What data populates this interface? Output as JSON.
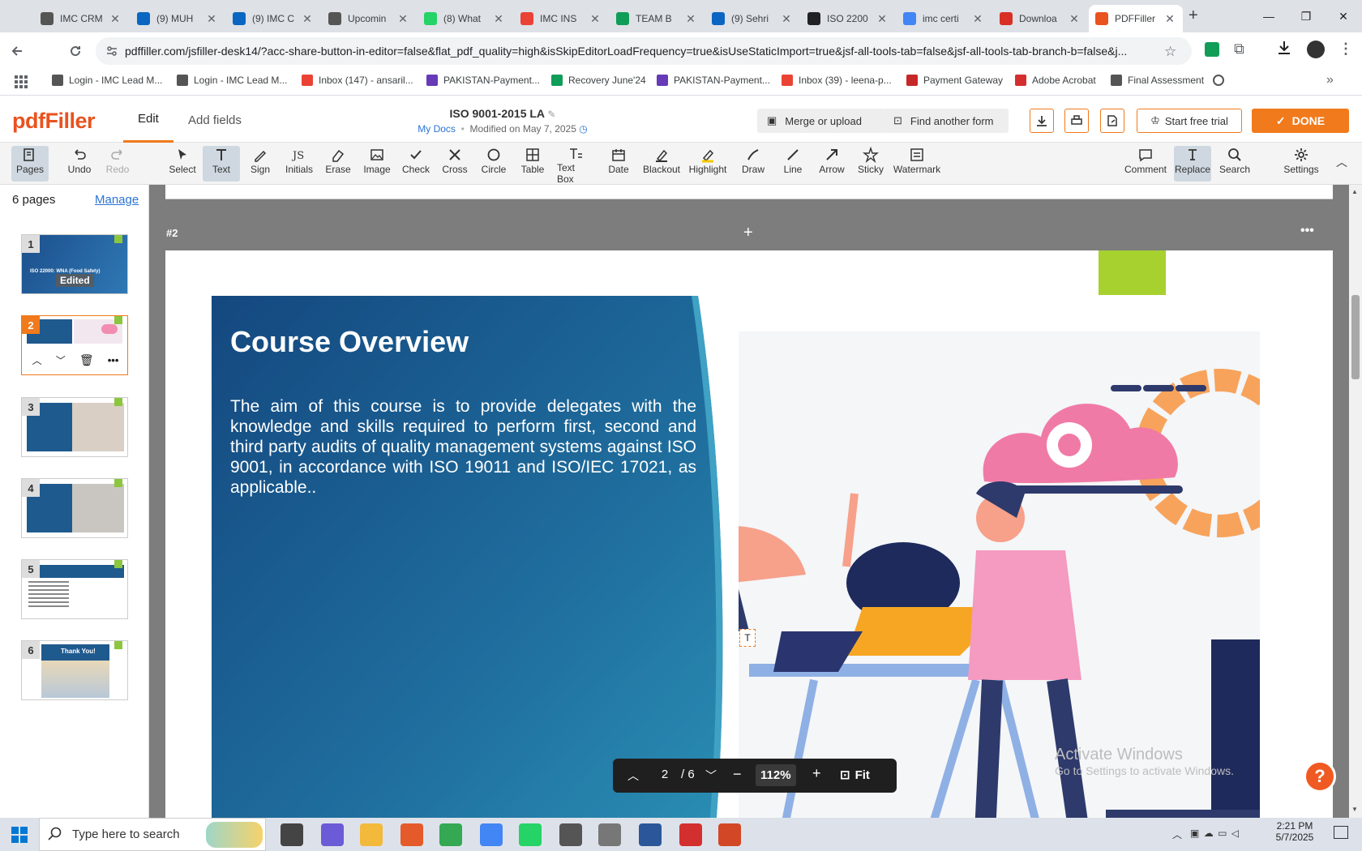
{
  "browser": {
    "tabs": [
      {
        "title": "IMC CRM",
        "icon": "gear-favicon",
        "color": "#555555"
      },
      {
        "title": "(9) MUH",
        "icon": "linkedin-favicon",
        "color": "#0a66c2"
      },
      {
        "title": "(9) IMC C",
        "icon": "linkedin-favicon",
        "color": "#0a66c2"
      },
      {
        "title": "Upcomin",
        "icon": "gear-favicon",
        "color": "#555555"
      },
      {
        "title": "(8) What",
        "icon": "whatsapp-favicon",
        "color": "#25d366"
      },
      {
        "title": "IMC INS",
        "icon": "gmail-favicon",
        "color": "#ea4335"
      },
      {
        "title": "TEAM B",
        "icon": "sheets-favicon",
        "color": "#0f9d58"
      },
      {
        "title": "(9) Sehri",
        "icon": "linkedin-favicon",
        "color": "#0a66c2"
      },
      {
        "title": "ISO 2200",
        "icon": "openai-favicon",
        "color": "#202124"
      },
      {
        "title": "imc certi",
        "icon": "google-favicon",
        "color": "#4285f4"
      },
      {
        "title": "Downloa",
        "icon": "heart-favicon",
        "color": "#d93025"
      },
      {
        "title": "PDFFiller",
        "icon": "pdffiller-favicon",
        "color": "#e8531f"
      }
    ],
    "new_tab": "+",
    "url": "pdffiller.com/jsfiller-desk14/?acc-share-button-in-editor=false&flat_pdf_quality=high&isSkipEditorLoadFrequency=true&isUseStaticImport=true&jsf-all-tools-tab=false&jsf-all-tools-tab-branch-b=false&j...",
    "bookmarks": [
      {
        "label": "Login - IMC Lead M...",
        "color": "#555555"
      },
      {
        "label": "Login - IMC Lead M...",
        "color": "#555555"
      },
      {
        "label": "Inbox (147) - ansaril...",
        "color": "#ea4335"
      },
      {
        "label": "PAKISTAN-Payment...",
        "color": "#673ab7"
      },
      {
        "label": "Recovery June'24",
        "color": "#0f9d58"
      },
      {
        "label": "PAKISTAN-Payment...",
        "color": "#673ab7"
      },
      {
        "label": "Inbox (39) - leena-p...",
        "color": "#ea4335"
      },
      {
        "label": "Payment Gateway",
        "color": "#c62828"
      },
      {
        "label": "Adobe Acrobat",
        "color": "#d32f2f"
      },
      {
        "label": "Final Assessment",
        "color": "#555555"
      }
    ]
  },
  "app": {
    "logo": "pdfFiller",
    "tabs": [
      "Edit",
      "Add fields"
    ],
    "doc_title": "ISO 9001-2015 LA",
    "my_docs": "My Docs",
    "modified": "Modified on May 7, 2025",
    "merge": "Merge or upload",
    "find": "Find another form",
    "trial": "Start free trial",
    "done": "DONE",
    "accent": "#f07a1c"
  },
  "toolbar": {
    "pages": "Pages",
    "undo": "Undo",
    "redo": "Redo",
    "select": "Select",
    "text": "Text",
    "sign": "Sign",
    "initials": "Initials",
    "erase": "Erase",
    "image": "Image",
    "check": "Check",
    "cross": "Cross",
    "circle": "Circle",
    "table": "Table",
    "textbox": "Text Box",
    "date": "Date",
    "blackout": "Blackout",
    "highlight": "Highlight",
    "draw": "Draw",
    "line": "Line",
    "arrow": "Arrow",
    "sticky": "Sticky",
    "watermark": "Watermark",
    "comment": "Comment",
    "replace": "Replace",
    "search": "Search",
    "settings": "Settings"
  },
  "sidebar": {
    "count": "6 pages",
    "manage": "Manage",
    "edited": "Edited",
    "thumbs": [
      "1",
      "2",
      "3",
      "4",
      "5",
      "6"
    ],
    "thumb1_title": "ISO 22000: WNA (Food Safety)",
    "thumb6_title": "Thank You!"
  },
  "page": {
    "marker": "#2",
    "title": "Course Overview",
    "body": "The aim of this course is to provide delegates with the knowledge and skills required to perform first, second and third party audits of quality management systems against ISO 9001, in accordance with ISO 19011 and ISO/IEC 17021, as applicable..",
    "text_marker": "T"
  },
  "controls": {
    "page": "2",
    "total": "/ 6",
    "zoom": "112%",
    "fit": "Fit"
  },
  "watermark": {
    "line1": "Activate Windows",
    "line2": "Go to Settings to activate Windows."
  },
  "taskbar": {
    "search": "Type here to search",
    "time": "2:21 PM",
    "date": "5/7/2025"
  }
}
